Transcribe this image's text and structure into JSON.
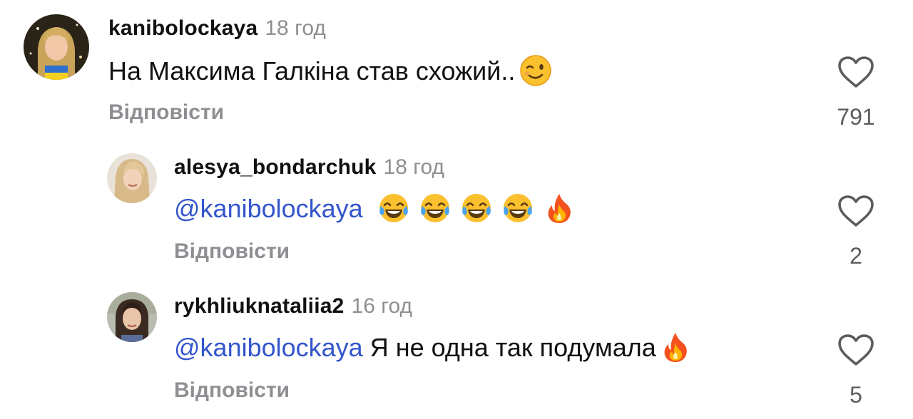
{
  "comments": [
    {
      "username": "kanibolockaya",
      "time": "18 год",
      "mention": "",
      "text": "На Максима Галкіна став схожий..",
      "emojis": [
        "winking-face"
      ],
      "reply_label": "Відповісти",
      "likes": "791"
    },
    {
      "username": "alesya_bondarchuk",
      "time": "18 год",
      "mention": "@kanibolockaya",
      "text": "",
      "emojis": [
        "tears-of-joy",
        "tears-of-joy",
        "tears-of-joy",
        "tears-of-joy",
        "fire"
      ],
      "reply_label": "Відповісти",
      "likes": "2"
    },
    {
      "username": "rykhliuknataliia2",
      "time": "16 год",
      "mention": "@kanibolockaya",
      "text": "Я не одна так подумала",
      "emojis": [
        "fire"
      ],
      "reply_label": "Відповісти",
      "likes": "5"
    }
  ],
  "colors": {
    "mention": "#3355cc",
    "secondary_text": "#8e8e93",
    "primary_text": "#111111"
  }
}
